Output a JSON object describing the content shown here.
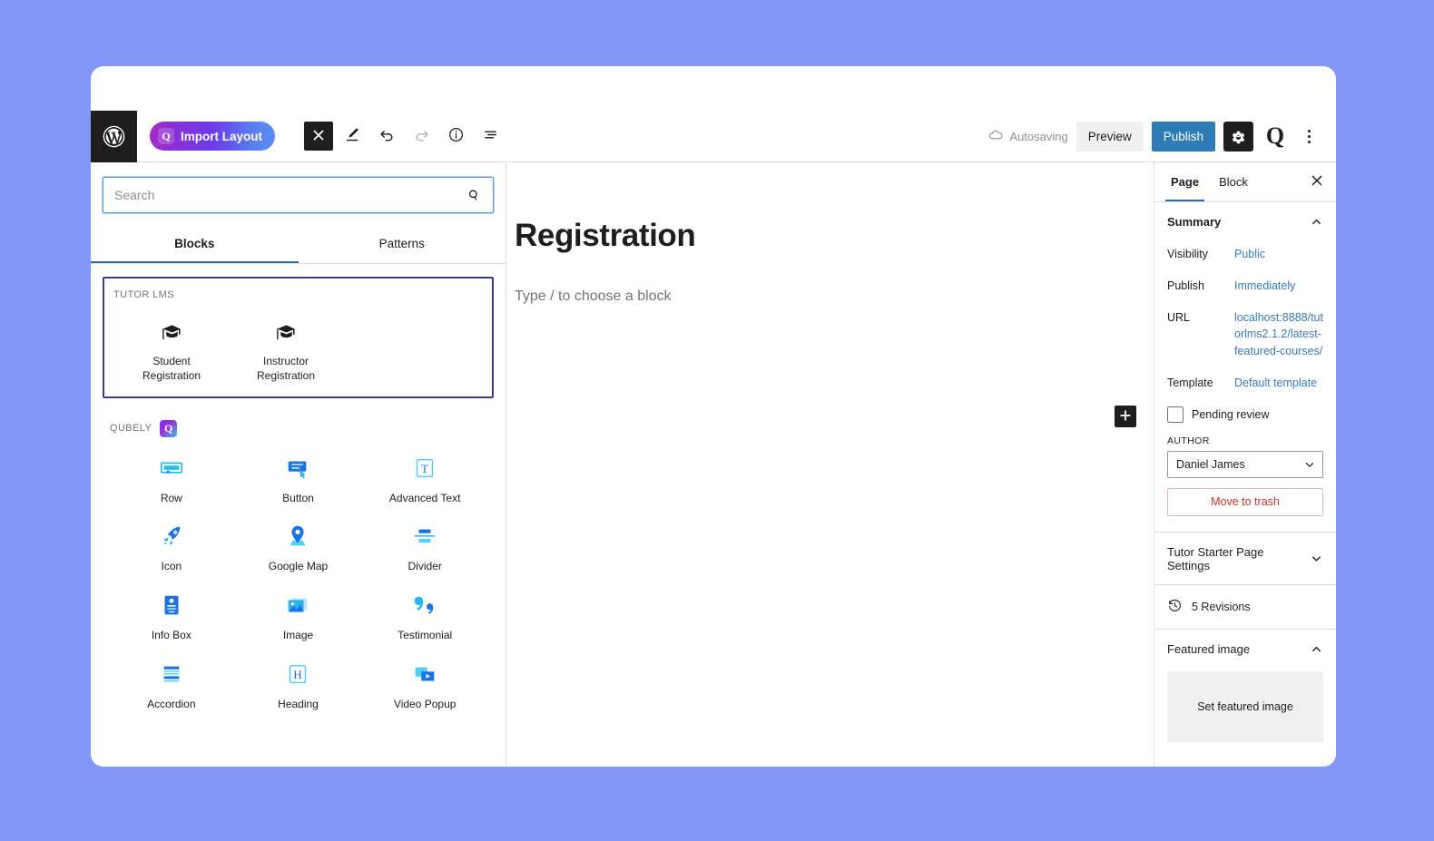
{
  "window": {
    "background_color": "#8297f7",
    "card_color": "#ffffff"
  },
  "toolbar": {
    "wp_logo_icon": "wordpress-logo-icon",
    "import_layout_label": "Import Layout",
    "import_layout_badge": "Q",
    "close_icon": "close-icon",
    "edit_icon": "pencil-edit-icon",
    "undo_icon": "undo-icon",
    "redo_icon": "redo-icon",
    "info_icon": "info-icon",
    "list_view_icon": "list-view-icon",
    "autosaving_label": "Autosaving",
    "autosaving_icon": "cloud-icon",
    "preview_label": "Preview",
    "publish_label": "Publish",
    "gear_icon": "gear-icon",
    "qubely_logo": "Q",
    "kebab_icon": "kebab-menu-icon",
    "publish_color": "#2d7cb5"
  },
  "inserter": {
    "search": {
      "value": "",
      "placeholder": "Search",
      "icon": "search-icon"
    },
    "tabs": [
      {
        "label": "Blocks",
        "active": true
      },
      {
        "label": "Patterns",
        "active": false
      }
    ],
    "tutor_group": {
      "label": "TUTOR LMS",
      "items": [
        {
          "label": "Student Registration",
          "icon": "graduation-cap-icon"
        },
        {
          "label": "Instructor Registration",
          "icon": "graduation-cap-icon"
        }
      ]
    },
    "qubely_group": {
      "label": "QUBELY",
      "badge": "Q",
      "items": [
        {
          "label": "Row",
          "icon": "row-block-icon"
        },
        {
          "label": "Button",
          "icon": "button-block-icon"
        },
        {
          "label": "Advanced Text",
          "icon": "advanced-text-block-icon"
        },
        {
          "label": "Icon",
          "icon": "rocket-icon"
        },
        {
          "label": "Google Map",
          "icon": "map-pin-icon"
        },
        {
          "label": "Divider",
          "icon": "divider-block-icon"
        },
        {
          "label": "Info Box",
          "icon": "info-box-block-icon"
        },
        {
          "label": "Image",
          "icon": "image-block-icon"
        },
        {
          "label": "Testimonial",
          "icon": "quote-icon"
        },
        {
          "label": "Accordion",
          "icon": "accordion-block-icon"
        },
        {
          "label": "Heading",
          "icon": "heading-block-icon"
        },
        {
          "label": "Video Popup",
          "icon": "video-popup-block-icon"
        }
      ]
    }
  },
  "editor": {
    "post_title": "Registration",
    "block_placeholder": "Type / to choose a block",
    "add_block_icon": "plus-icon"
  },
  "settings": {
    "tabs": [
      {
        "label": "Page",
        "active": true
      },
      {
        "label": "Block",
        "active": false
      }
    ],
    "close_icon": "close-icon",
    "summary": {
      "title": "Summary",
      "chevron": "chevron-up-icon",
      "rows": [
        {
          "key": "Visibility",
          "value": "Public"
        },
        {
          "key": "Publish",
          "value": "Immediately"
        },
        {
          "key": "URL",
          "value": "localhost:8888/tutorlms2.1.2/latest-featured-courses/"
        },
        {
          "key": "Template",
          "value": "Default template"
        }
      ],
      "pending_review_label": "Pending review",
      "pending_review_checked": false,
      "author_label": "AUTHOR",
      "author_value": "Daniel James",
      "move_to_trash_label": "Move to trash",
      "trash_color": "#cc3333"
    },
    "starter_settings": {
      "title": "Tutor Starter Page Settings",
      "chevron": "chevron-down-icon"
    },
    "revisions": {
      "label": "5 Revisions",
      "icon": "revision-clock-icon"
    },
    "featured_image": {
      "title": "Featured image",
      "chevron": "chevron-up-icon",
      "placeholder_label": "Set featured image"
    }
  }
}
